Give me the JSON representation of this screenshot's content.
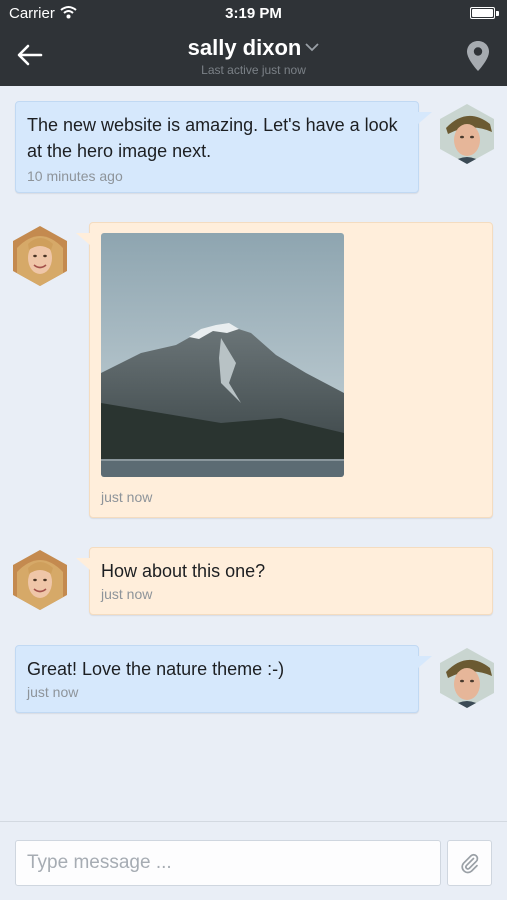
{
  "status_bar": {
    "carrier": "Carrier",
    "time": "3:19 PM"
  },
  "header": {
    "contact_name": "sally dixon",
    "last_active": "Last active just now",
    "back_icon": "arrow-left-icon",
    "location_icon": "map-pin-icon"
  },
  "messages": [
    {
      "direction": "outgoing",
      "text": "The new website is amazing. Let's have a look at the hero image next.",
      "timestamp": "10 minutes ago"
    },
    {
      "direction": "incoming",
      "type": "image",
      "image": "mountain lake photo",
      "timestamp": "just now"
    },
    {
      "direction": "incoming",
      "text": "How about this one?",
      "timestamp": "just now"
    },
    {
      "direction": "outgoing",
      "text": "Great! Love the nature theme :-)",
      "timestamp": "just now"
    }
  ],
  "composer": {
    "placeholder": "Type message ...",
    "attach_icon": "paperclip-icon"
  },
  "colors": {
    "header_bg": "#2f3337",
    "background": "#e9eef6",
    "outgoing_bubble": "#d6e8fc",
    "incoming_bubble": "#ffeedb"
  }
}
